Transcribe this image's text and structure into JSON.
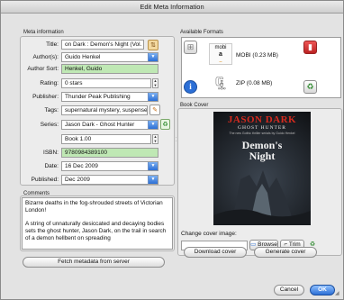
{
  "window": {
    "title": "Edit Meta Information"
  },
  "meta": {
    "group_label": "Meta information",
    "title_label": "Title:",
    "title_value": "on Dark : Demon's Night (Vol. 1)",
    "authors_label": "Author(s):",
    "authors_value": "Guido Henkel",
    "author_sort_label": "Author Sort:",
    "author_sort_value": "Henkel, Guido",
    "rating_label": "Rating:",
    "rating_value": "0 stars",
    "publisher_label": "Publisher:",
    "publisher_value": "Thunder Peak Publishing",
    "tags_label": "Tags:",
    "tags_value": "supernatural mystery, suspense",
    "series_label": "Series:",
    "series_value": "Jason Dark - Ghost Hunter",
    "book_value": "Book 1.00",
    "isbn_label": "ISBN:",
    "isbn_value": "9780984389100",
    "date_label": "Date:",
    "date_value": "16 Dec 2009",
    "published_label": "Published:",
    "published_value": "Dec 2009"
  },
  "comments": {
    "group_label": "Comments",
    "text": "Bizarre deaths in the fog-shrouded streets of Victorian London!\n\nA string of unnaturally desiccated and decaying bodies sets the ghost hunter, Jason Dark, on the trail in search of a demon hellbent on spreading"
  },
  "fetch_button": "Fetch metadata from server",
  "formats": {
    "group_label": "Available Formats",
    "items": [
      {
        "name": "MOBI (0.23 MB)",
        "icon": "mobi-amazon-icon"
      },
      {
        "name": "ZIP (0.08 MB)",
        "icon": "zip-icon"
      }
    ]
  },
  "cover": {
    "group_label": "Book Cover",
    "title_line1": "JASON DARK",
    "title_line2": "GHOST HUNTER",
    "tagline": "The new Gothic thriller serials by Guido Henkel",
    "book_title_1": "Demon's",
    "book_title_2": "Night"
  },
  "change_cover": {
    "label": "Change cover image:",
    "browse": "Browse",
    "trim": "Trim",
    "download": "Download cover",
    "generate": "Generate cover"
  },
  "dialog": {
    "cancel": "Cancel",
    "ok": "OK"
  },
  "colors": {
    "accent_blue": "#2c6fd6",
    "green_field": "#bfe8b4",
    "cover_red": "#d62a1e"
  }
}
